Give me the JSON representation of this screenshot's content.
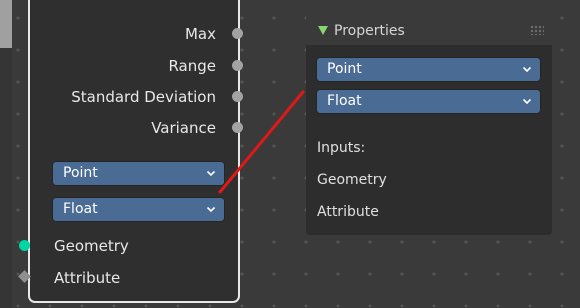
{
  "node": {
    "outputs": [
      {
        "label": "Max"
      },
      {
        "label": "Range"
      },
      {
        "label": "Standard Deviation"
      },
      {
        "label": "Variance"
      }
    ],
    "domain_dropdown": "Point",
    "type_dropdown": "Float",
    "inputs": [
      {
        "label": "Geometry"
      },
      {
        "label": "Attribute"
      }
    ]
  },
  "properties_panel": {
    "title": "Properties",
    "domain_dropdown": "Point",
    "type_dropdown": "Float",
    "inputs_heading": "Inputs:",
    "inputs": [
      "Geometry",
      "Attribute"
    ]
  },
  "colors": {
    "dropdown_bg": "#4a6b93",
    "geometry_socket": "#00d6a3",
    "panel_triangle": "#86d472",
    "annotation_line": "#e01818"
  },
  "icons": {
    "dropdown_chevron": "chevron-down-icon",
    "panel_collapse": "triangle-down-icon",
    "panel_grip": "drag-grip-icon"
  }
}
